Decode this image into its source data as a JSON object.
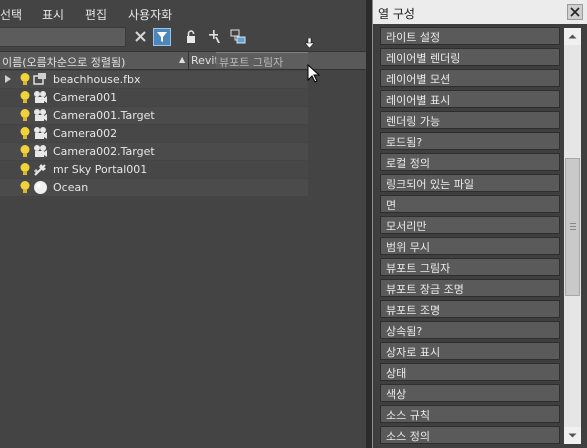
{
  "menubar": {
    "items": [
      "선택",
      "표시",
      "편집",
      "사용자화"
    ]
  },
  "toolbar": {
    "search_value": "",
    "icons": [
      "clear-search-icon",
      "filter-icon",
      "lock-icon",
      "add-node-icon",
      "link-icon"
    ]
  },
  "column_header": {
    "name_label": "이름(오름차순으로 정렬됨)",
    "second_label": "Revit",
    "dragging_label": "뷰포트 그림자"
  },
  "scene_rows": [
    {
      "name": "beachhouse.fbx",
      "icon": "group-icon",
      "expandable": true
    },
    {
      "name": "Camera001",
      "icon": "camera-icon",
      "expandable": false
    },
    {
      "name": "Camera001.Target",
      "icon": "camera-icon",
      "expandable": false
    },
    {
      "name": "Camera002",
      "icon": "camera-icon",
      "expandable": false
    },
    {
      "name": "Camera002.Target",
      "icon": "camera-icon",
      "expandable": false
    },
    {
      "name": "mr Sky Portal001",
      "icon": "light-icon",
      "expandable": false
    },
    {
      "name": "Ocean",
      "icon": "sphere-icon",
      "expandable": false
    }
  ],
  "column_config": {
    "title": "열 구성",
    "items": [
      "라이트 설정",
      "레이어별 렌더링",
      "레이어별 모션",
      "레이어별 표시",
      "렌더링 가능",
      "로드됨?",
      "로컬 정의",
      "링크되어 있는 파일",
      "면",
      "모서리만",
      "범위 무시",
      "뷰포트 그림자",
      "뷰포트 장금 조명",
      "뷰포트 조명",
      "상속됨?",
      "상자로 표시",
      "상태",
      "색상",
      "소스 규칙",
      "소스 정의"
    ]
  },
  "colors": {
    "filter_active": "#4d86b8",
    "bulb": "#f2d23a"
  }
}
